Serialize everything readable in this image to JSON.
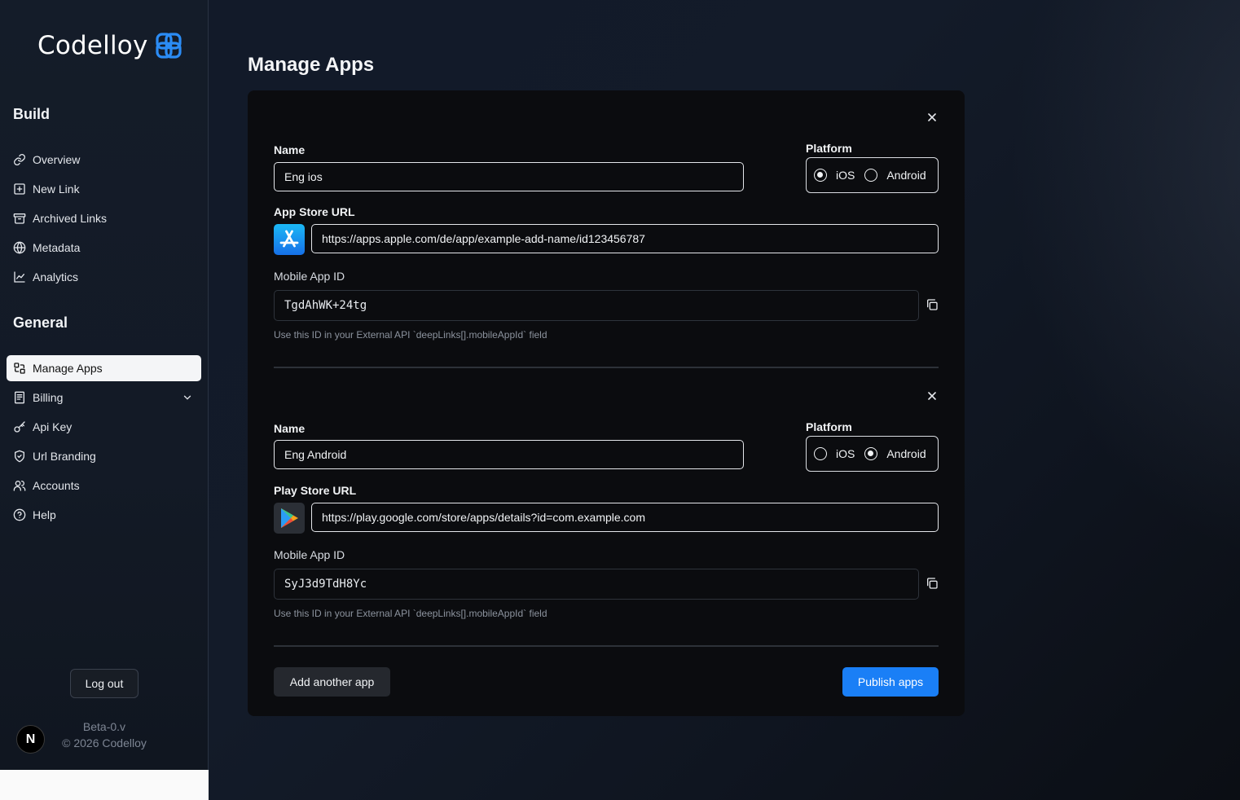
{
  "brand": {
    "name": "Codelloy"
  },
  "sidebar": {
    "sections": [
      {
        "title": "Build"
      },
      {
        "title": "General"
      }
    ],
    "build_items": [
      {
        "label": "Overview",
        "icon": "link-icon"
      },
      {
        "label": "New Link",
        "icon": "plus-square-icon"
      },
      {
        "label": "Archived Links",
        "icon": "archive-icon"
      },
      {
        "label": "Metadata",
        "icon": "globe-icon"
      },
      {
        "label": "Analytics",
        "icon": "line-chart-icon"
      }
    ],
    "general_items": [
      {
        "label": "Manage Apps",
        "icon": "apps-icon",
        "active": true
      },
      {
        "label": "Billing",
        "icon": "receipt-icon",
        "expandable": true
      },
      {
        "label": "Api Key",
        "icon": "key-icon"
      },
      {
        "label": "Url Branding",
        "icon": "shield-check-icon"
      },
      {
        "label": "Accounts",
        "icon": "users-icon"
      },
      {
        "label": "Help",
        "icon": "help-circle-icon"
      }
    ],
    "logout_label": "Log out",
    "avatar_letter": "N",
    "version": "Beta-0.v",
    "copyright": "© 2026 Codelloy"
  },
  "page": {
    "title": "Manage Apps"
  },
  "apps": [
    {
      "name_label": "Name",
      "name_value": "Eng ios",
      "platform_label": "Platform",
      "platform_options": [
        "iOS",
        "Android"
      ],
      "selected_platform": "iOS",
      "url_label": "App Store URL",
      "url_value": "https://apps.apple.com/de/app/example-add-name/id123456787",
      "store_icon": "app-store-icon",
      "id_label": "Mobile App ID",
      "id_value": "TgdAhWK+24tg",
      "hint": "Use this ID in your External API `deepLinks[].mobileAppId` field"
    },
    {
      "name_label": "Name",
      "name_value": "Eng Android",
      "platform_label": "Platform",
      "platform_options": [
        "iOS",
        "Android"
      ],
      "selected_platform": "Android",
      "url_label": "Play Store URL",
      "url_value": "https://play.google.com/store/apps/details?id=com.example.com",
      "store_icon": "play-store-icon",
      "id_label": "Mobile App ID",
      "id_value": "SyJ3d9TdH8Yc",
      "hint": "Use this ID in your External API `deepLinks[].mobileAppId` field"
    }
  ],
  "actions": {
    "add_label": "Add another app",
    "publish_label": "Publish apps"
  },
  "colors": {
    "primary": "#1a7ff6",
    "logo_accent": "#2b8cf5"
  }
}
